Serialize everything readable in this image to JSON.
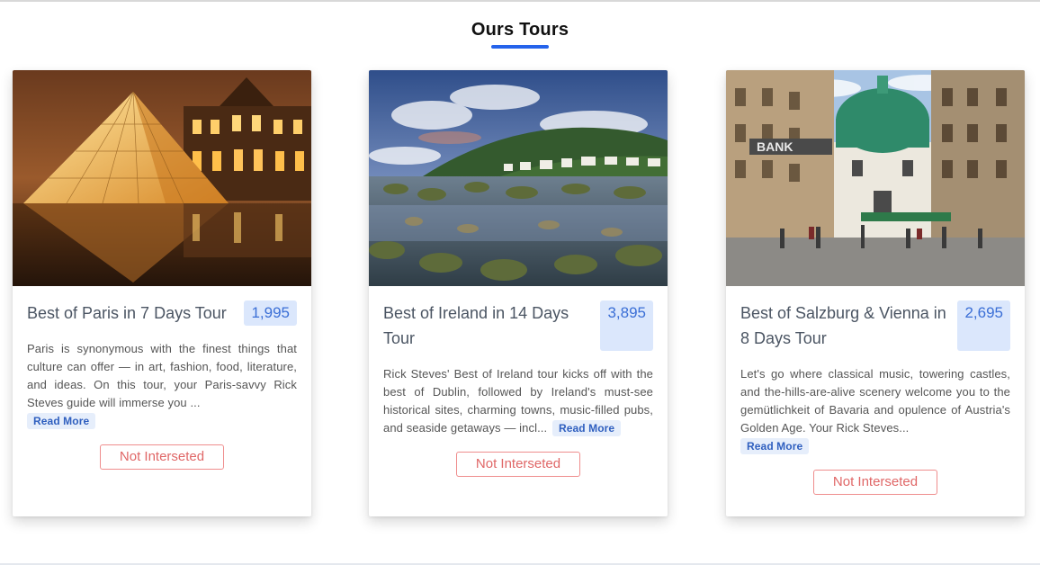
{
  "section": {
    "title": "Ours Tours",
    "accent_color": "#2563eb"
  },
  "tours": [
    {
      "title": "Best of Paris in 7 Days Tour",
      "price": "1,995",
      "description": "Paris is synonymous with the finest things that culture can offer — in art, fashion, food, literature, and ideas. On this tour, your Paris-savvy Rick Steves guide will immerse you ...",
      "read_more": "Read More",
      "button": "Not Interseted",
      "photo": "paris-louvre-pyramid-photo"
    },
    {
      "title": "Best of Ireland in 14 Days Tour",
      "price": "3,895",
      "description": "Rick Steves' Best of Ireland tour kicks off with the best of Dublin, followed by Ireland's must-see historical sites, charming towns, music-filled pubs, and seaside getaways — incl...",
      "read_more": "Read More",
      "button": "Not Interseted",
      "photo": "ireland-coast-photo"
    },
    {
      "title": "Best of Salzburg & Vienna in 8 Days Tour",
      "price": "2,695",
      "description": "Let's go where classical music, towering castles, and the-hills-are-alive scenery welcome you to the gemütlichkeit of Bavaria and opulence of Austria's Golden Age. Your Rick Steves...",
      "read_more": "Read More",
      "button": "Not Interseted",
      "photo": "vienna-street-photo"
    }
  ],
  "colors": {
    "price_bg": "#dbe7fc",
    "price_text": "#3b6fd6",
    "button_border": "#ef8d8d",
    "button_text": "#e06767"
  }
}
